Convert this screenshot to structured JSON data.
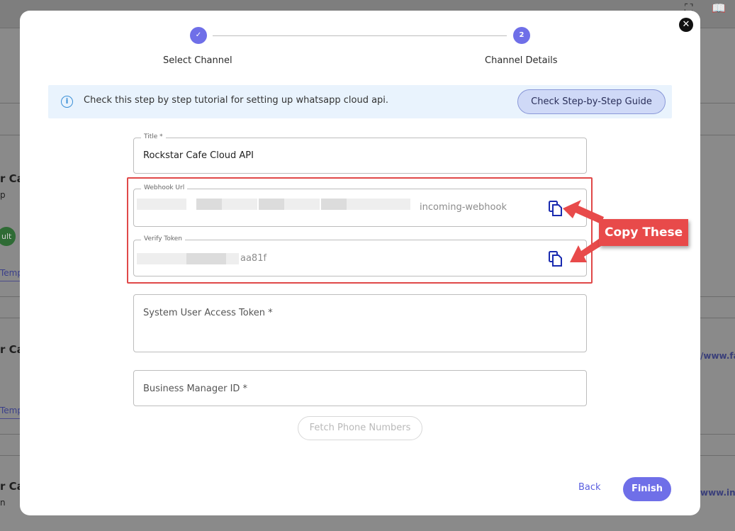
{
  "stepper": {
    "steps": [
      {
        "label": "Select Channel",
        "state": "complete",
        "marker": "✓"
      },
      {
        "label": "Channel Details",
        "state": "active",
        "marker": "2"
      }
    ]
  },
  "banner": {
    "text": "Check this step by step tutorial for setting up whatsapp cloud api.",
    "button": "Check Step-by-Step Guide"
  },
  "form": {
    "title": {
      "legend": "Title *",
      "value": "Rockstar Cafe Cloud API"
    },
    "webhook": {
      "legend": "Webhook Url",
      "value": "incoming-webhook"
    },
    "verify": {
      "legend": "Verify Token",
      "value": "aa81f"
    },
    "access_token": {
      "placeholder": "System User Access Token *"
    },
    "business_id": {
      "placeholder": "Business Manager ID *"
    },
    "fetch_button": "Fetch Phone Numbers"
  },
  "annotation": {
    "text": "Copy These"
  },
  "footer": {
    "back": "Back",
    "finish": "Finish"
  },
  "background": {
    "row1_title": "r Ca",
    "row1_sub": "p",
    "row1_pill": "ult",
    "row1_link": "Temp",
    "row2_title": "r Ca",
    "row2_link": "Temp",
    "row2_url": "/www.fa",
    "row3_title": "r Ca",
    "row3_sub": "n",
    "row3_url": "www.ins"
  },
  "colors": {
    "accent": "#6f6fe8",
    "highlight": "#e04848",
    "banner_bg": "#e9f3fd"
  }
}
